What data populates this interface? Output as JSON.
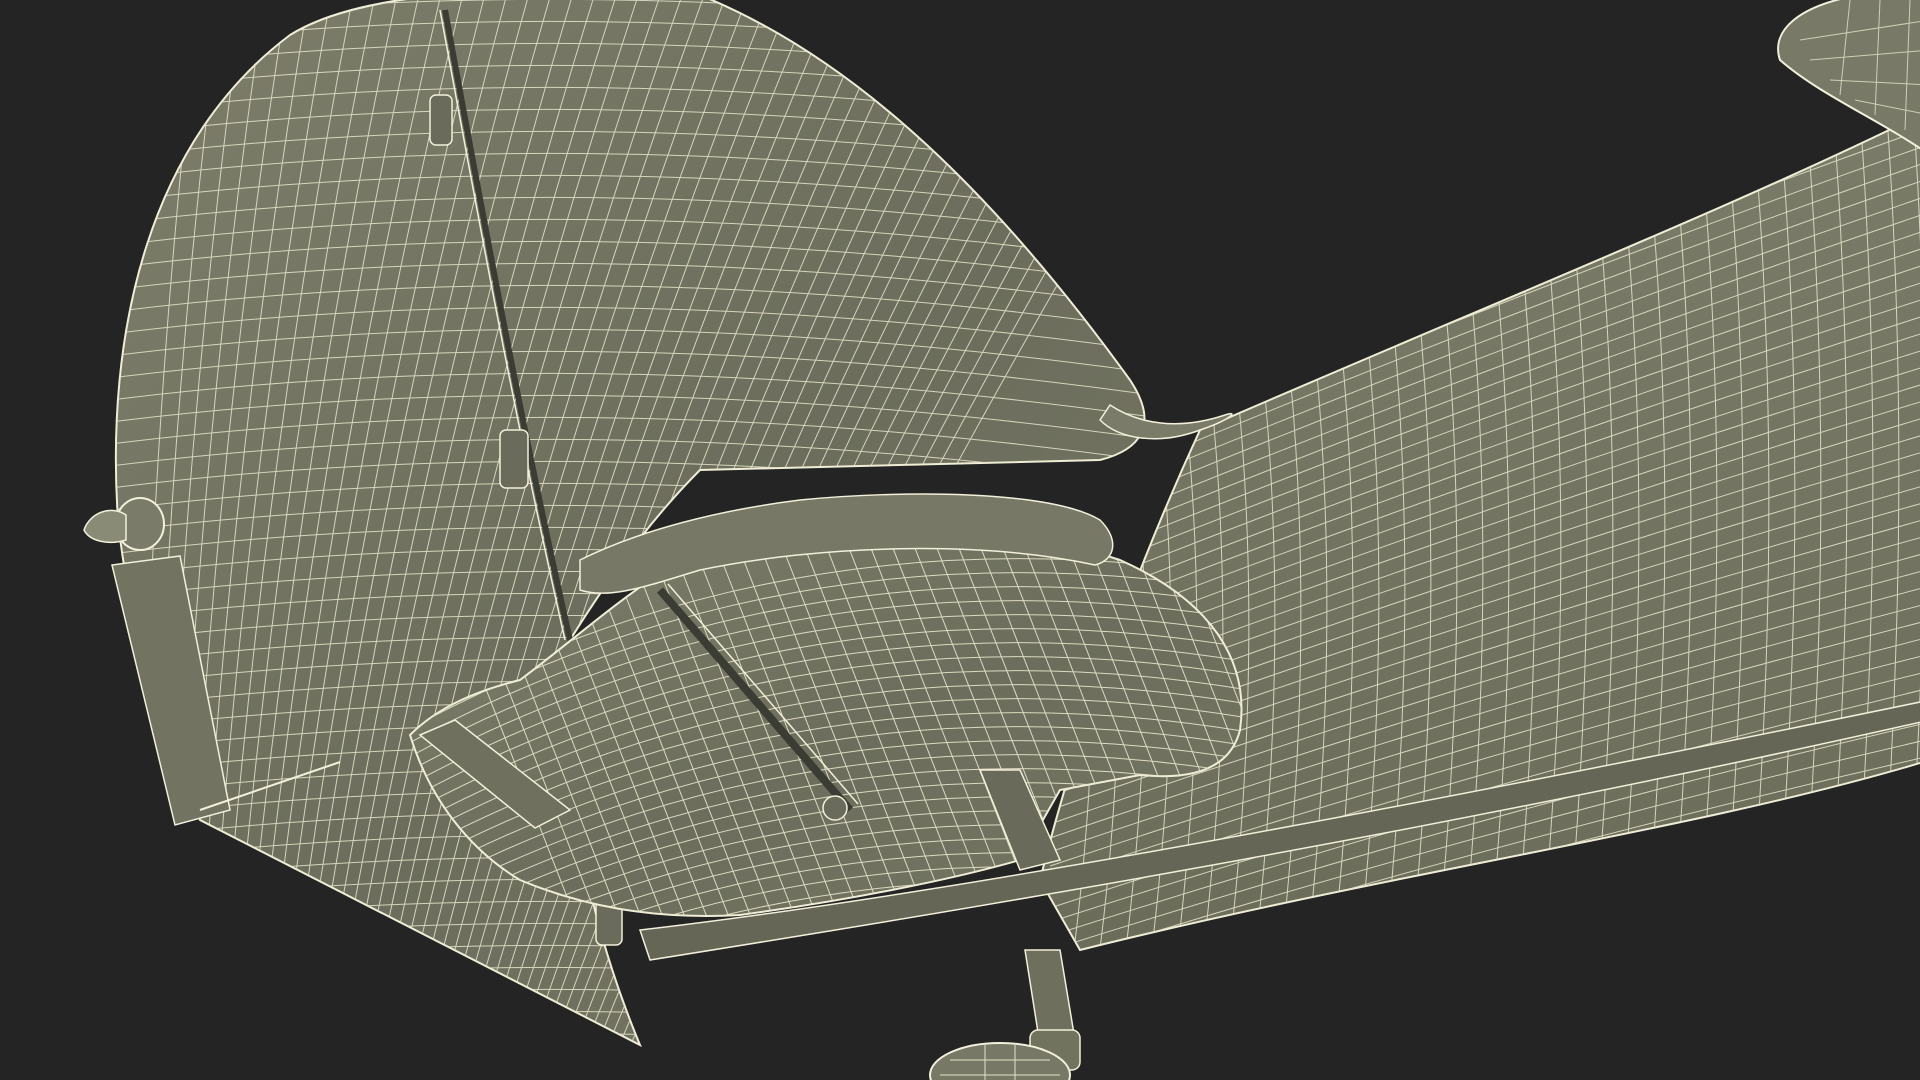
{
  "scene": {
    "subject": "aircraft-tail-wireframe",
    "render_style": "wireframe",
    "colors": {
      "background": "#242424",
      "surface": "#6f705f",
      "surface_dark": "#5f604f",
      "surface_light": "#7f806c",
      "wire": "#e8e6cc",
      "wire_dense": "#f2f0da"
    }
  }
}
